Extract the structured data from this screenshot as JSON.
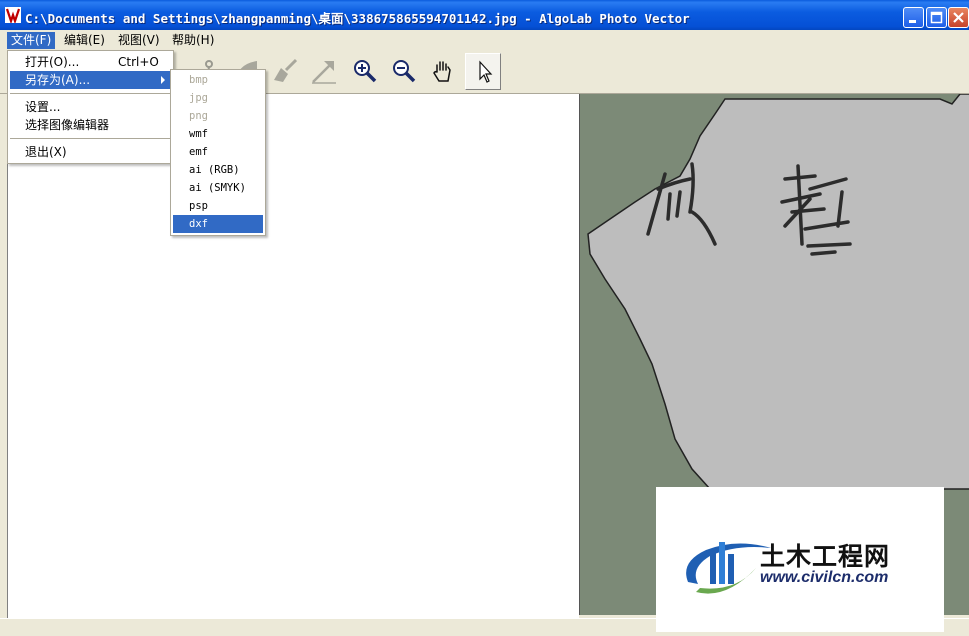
{
  "window": {
    "title": "C:\\Documents and Settings\\zhangpanming\\桌面\\338675865594701142.jpg - AlgoLab Photo Vector"
  },
  "menubar": {
    "items": [
      {
        "label": "文件(F)"
      },
      {
        "label": "编辑(E)"
      },
      {
        "label": "视图(V)"
      },
      {
        "label": "帮助(H)"
      }
    ]
  },
  "file_menu": {
    "open": {
      "label": "打开(O)...",
      "shortcut": "Ctrl+O"
    },
    "save_as": {
      "label": "另存为(A)..."
    },
    "settings": {
      "label": "设置..."
    },
    "choose_editor": {
      "label": "选择图像编辑器"
    },
    "exit": {
      "label": "退出(X)"
    }
  },
  "save_as_submenu": {
    "items": [
      {
        "label": "bmp",
        "enabled": false
      },
      {
        "label": "jpg",
        "enabled": false
      },
      {
        "label": "png",
        "enabled": false
      },
      {
        "label": "wmf",
        "enabled": true
      },
      {
        "label": "emf",
        "enabled": true
      },
      {
        "label": "ai (RGB)",
        "enabled": true
      },
      {
        "label": "ai (SMYK)",
        "enabled": true
      },
      {
        "label": "psp",
        "enabled": true
      },
      {
        "label": "dxf",
        "enabled": true,
        "highlighted": true
      }
    ]
  },
  "toolbar": {
    "buttons": [
      {
        "icon": "scissors-icon"
      },
      {
        "icon": "shape-icon"
      },
      {
        "icon": "brush-icon"
      },
      {
        "icon": "arrow-icon"
      },
      {
        "icon": "zoom-in-icon"
      },
      {
        "icon": "zoom-out-icon"
      },
      {
        "icon": "hand-pan-icon"
      },
      {
        "icon": "pointer-icon",
        "pressed": true
      }
    ]
  },
  "watermark": {
    "site_name": "土木工程网",
    "url": "www.civilcn.com"
  },
  "colors": {
    "menu_highlight": "#316ac5",
    "titlebar": "#0a5bdc",
    "image_background": "#7c8a77",
    "paper": "#bdbdbd"
  }
}
